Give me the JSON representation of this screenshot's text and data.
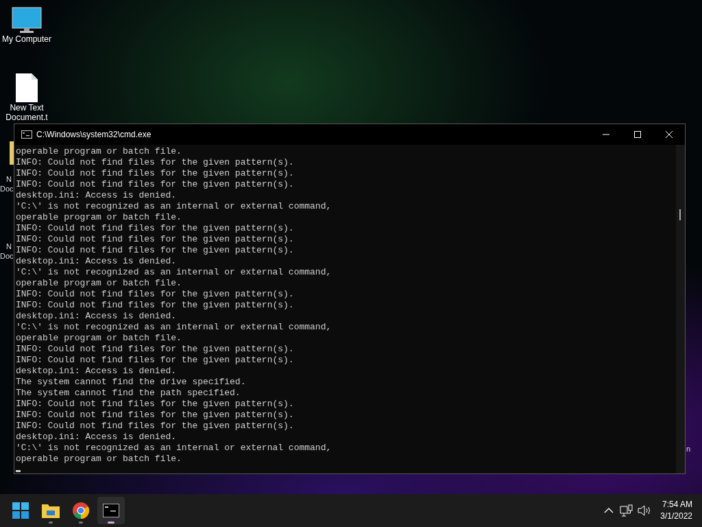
{
  "desktop_icons": [
    {
      "kind": "monitor",
      "label_lines": [
        "My Computer"
      ]
    },
    {
      "kind": "document",
      "label_lines": [
        "New Text",
        "Document.t"
      ]
    }
  ],
  "partial_labels": [
    "N",
    "Doc",
    "N",
    "Doc",
    "n"
  ],
  "window": {
    "title": "C:\\Windows\\system32\\cmd.exe",
    "lines": [
      "operable program or batch file.",
      "INFO: Could not find files for the given pattern(s).",
      "INFO: Could not find files for the given pattern(s).",
      "INFO: Could not find files for the given pattern(s).",
      "desktop.ini: Access is denied.",
      "'C:\\' is not recognized as an internal or external command,",
      "operable program or batch file.",
      "INFO: Could not find files for the given pattern(s).",
      "INFO: Could not find files for the given pattern(s).",
      "INFO: Could not find files for the given pattern(s).",
      "desktop.ini: Access is denied.",
      "'C:\\' is not recognized as an internal or external command,",
      "operable program or batch file.",
      "INFO: Could not find files for the given pattern(s).",
      "INFO: Could not find files for the given pattern(s).",
      "desktop.ini: Access is denied.",
      "'C:\\' is not recognized as an internal or external command,",
      "operable program or batch file.",
      "INFO: Could not find files for the given pattern(s).",
      "INFO: Could not find files for the given pattern(s).",
      "desktop.ini: Access is denied.",
      "The system cannot find the drive specified.",
      "The system cannot find the path specified.",
      "INFO: Could not find files for the given pattern(s).",
      "INFO: Could not find files for the given pattern(s).",
      "INFO: Could not find files for the given pattern(s).",
      "desktop.ini: Access is denied.",
      "'C:\\' is not recognized as an internal or external command,",
      "operable program or batch file."
    ]
  },
  "taskbar": {
    "apps": [
      {
        "kind": "start",
        "selected": false
      },
      {
        "kind": "explorer",
        "selected": false
      },
      {
        "kind": "chrome",
        "selected": false
      },
      {
        "kind": "terminal",
        "selected": true
      }
    ],
    "clock": {
      "time": "7:54 AM",
      "date": "3/1/2022"
    }
  }
}
